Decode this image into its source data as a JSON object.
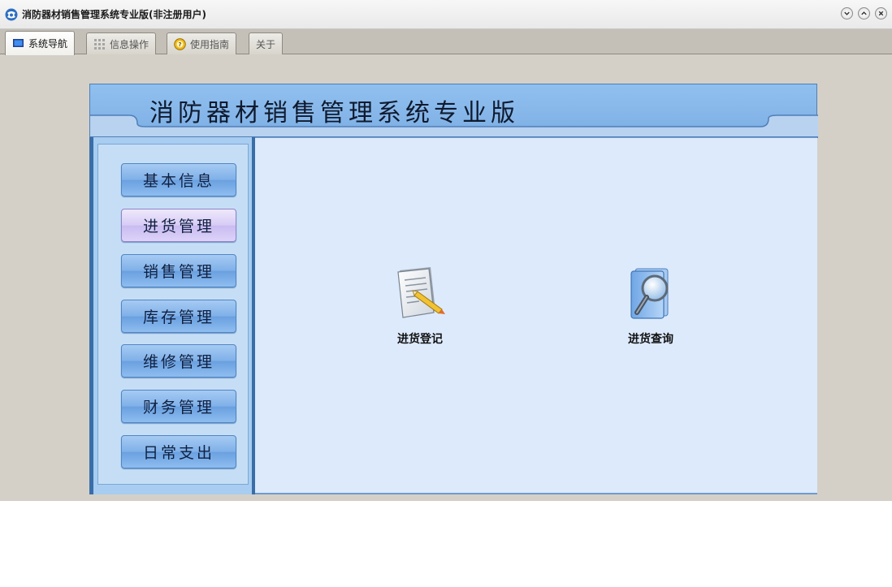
{
  "window": {
    "title": "消防器材销售管理系统专业版(非注册用户)",
    "icon": "app-logo-icon",
    "controls": [
      "minimize-icon",
      "maximize-icon",
      "close-icon"
    ]
  },
  "tabs": [
    {
      "label": "系统导航",
      "icon": "monitor-icon",
      "active": true
    },
    {
      "label": "信息操作",
      "icon": "grid-icon",
      "active": false
    },
    {
      "label": "使用指南",
      "icon": "help-icon",
      "active": false
    },
    {
      "label": "关于",
      "icon": "",
      "active": false
    }
  ],
  "banner": {
    "title": "消防器材销售管理系统专业版"
  },
  "sidebar": {
    "items": [
      {
        "label": "基本信息"
      },
      {
        "label": "进货管理",
        "selected": true
      },
      {
        "label": "销售管理"
      },
      {
        "label": "库存管理"
      },
      {
        "label": "维修管理"
      },
      {
        "label": "财务管理"
      },
      {
        "label": "日常支出"
      }
    ]
  },
  "main": {
    "actions": [
      {
        "label": "进货登记",
        "icon": "document-pencil-icon"
      },
      {
        "label": "进货查询",
        "icon": "magnifier-document-icon"
      }
    ]
  },
  "colors": {
    "banner": "#86b6e9",
    "sidebar_border": "#3a6ea8",
    "main_bg": "#ddeafc",
    "selected_button": "#d7ccf5"
  }
}
